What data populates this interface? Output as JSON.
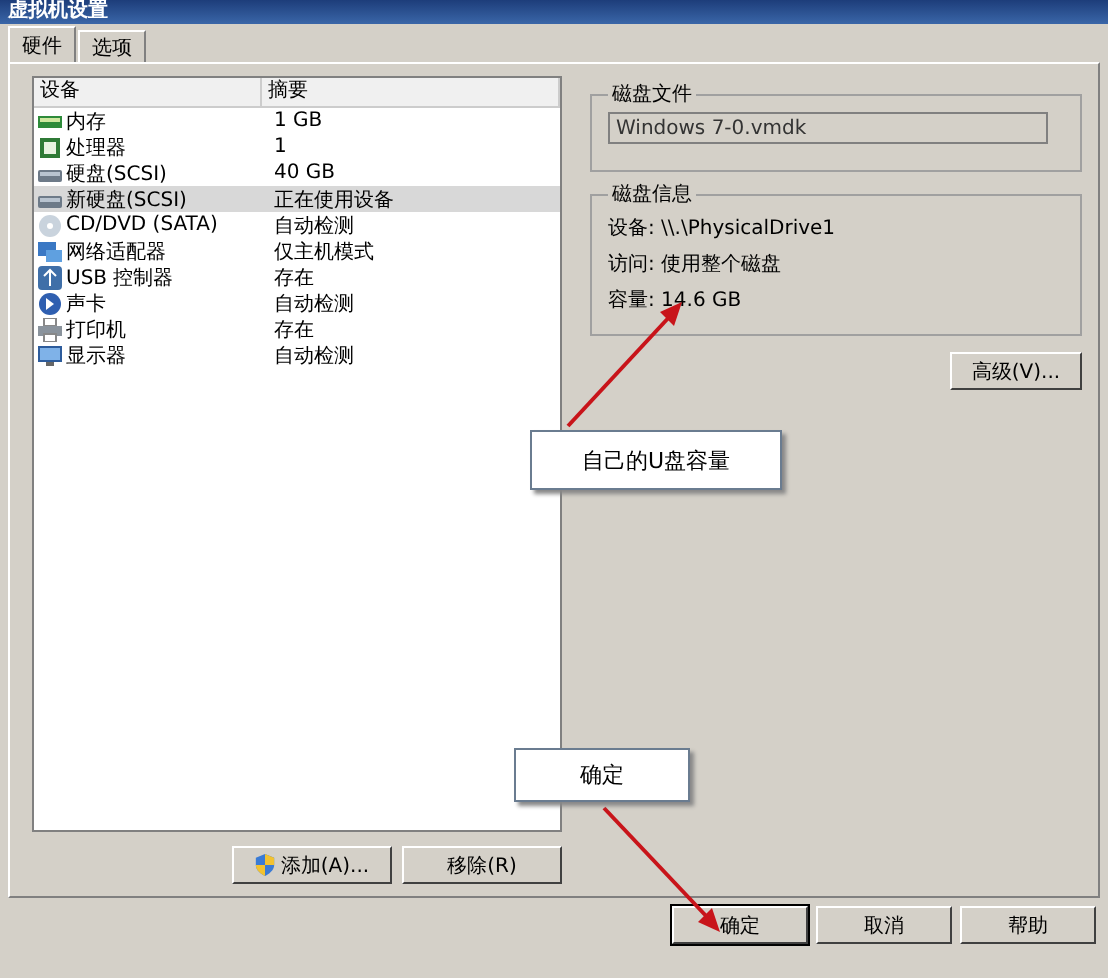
{
  "window": {
    "title": "虚拟机设置"
  },
  "tabs": [
    {
      "label": "硬件",
      "selected": true
    },
    {
      "label": "选项",
      "selected": false
    }
  ],
  "device_list": {
    "columns": [
      "设备",
      "摘要"
    ],
    "rows": [
      {
        "kind": "memory",
        "device": "内存",
        "summary": "1 GB",
        "selected": false
      },
      {
        "kind": "cpu",
        "device": "处理器",
        "summary": "1",
        "selected": false
      },
      {
        "kind": "disk",
        "device": "硬盘(SCSI)",
        "summary": "40 GB",
        "selected": false
      },
      {
        "kind": "disk",
        "device": "新硬盘(SCSI)",
        "summary": "正在使用设备",
        "selected": true
      },
      {
        "kind": "cd",
        "device": "CD/DVD (SATA)",
        "summary": "自动检测",
        "selected": false
      },
      {
        "kind": "network",
        "device": "网络适配器",
        "summary": "仅主机模式",
        "selected": false
      },
      {
        "kind": "usb",
        "device": "USB 控制器",
        "summary": "存在",
        "selected": false
      },
      {
        "kind": "sound",
        "device": "声卡",
        "summary": "自动检测",
        "selected": false
      },
      {
        "kind": "printer",
        "device": "打印机",
        "summary": "存在",
        "selected": false
      },
      {
        "kind": "display",
        "device": "显示器",
        "summary": "自动检测",
        "selected": false
      }
    ]
  },
  "list_buttons": [
    {
      "label": "添加(A)...",
      "shield": true
    },
    {
      "label": "移除(R)",
      "shield": false
    }
  ],
  "disk_file": {
    "title": "磁盘文件",
    "value": "Windows 7-0.vmdk"
  },
  "disk_info": {
    "title": "磁盘信息",
    "lines": [
      "设备: \\\\.\\PhysicalDrive1",
      "访问: 使用整个磁盘",
      "容量: 14.6 GB"
    ]
  },
  "advanced_button": "高级(V)...",
  "dialog_buttons": [
    "确定",
    "取消",
    "帮助"
  ],
  "callouts": [
    {
      "text": "自己的U盘容量"
    },
    {
      "text": "确定"
    }
  ]
}
